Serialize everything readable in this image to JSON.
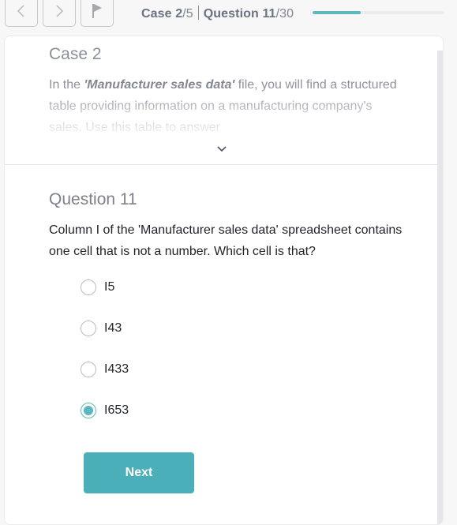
{
  "toolbar": {
    "prev_icon": "chevron-left-icon",
    "next_icon": "chevron-right-icon",
    "flag_icon": "flag-icon"
  },
  "progress": {
    "case_label": "Case",
    "case_current": "2",
    "case_total": "/5",
    "question_label": "Question",
    "question_current": "11",
    "question_total": "/30",
    "fraction_complete": 0.367,
    "accent_color": "#5cb8c3"
  },
  "case": {
    "title": "Case 2",
    "body_prefix": "In the ",
    "body_emphasis": "'Manufacturer sales data'",
    "body_rest": " file, you will find a structured table providing information on a manufacturing company's sales. Use this table to answer",
    "expand_icon": "chevron-down-icon"
  },
  "question": {
    "title": "Question 11",
    "text": "Column I of the 'Manufacturer sales data' spreadsheet contains one cell that is not a number. Which cell is that?",
    "options": [
      {
        "label": "I5",
        "selected": false
      },
      {
        "label": "I43",
        "selected": false
      },
      {
        "label": "I433",
        "selected": false
      },
      {
        "label": "I653",
        "selected": true
      }
    ]
  },
  "actions": {
    "next_label": "Next",
    "next_color": "#4aafb9"
  }
}
